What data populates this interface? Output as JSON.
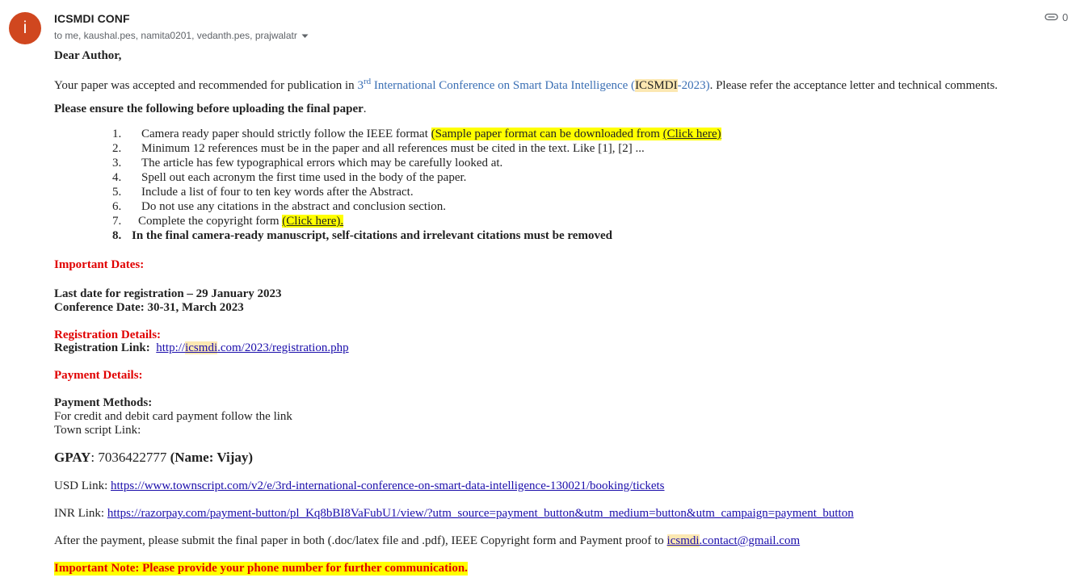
{
  "header": {
    "avatar_letter": "i",
    "sender": "ICSMDI CONF",
    "recipients": "to me, kaushal.pes, namita0201, vedanth.pes, prajwalatr",
    "attachment_count": "0"
  },
  "body": {
    "greeting": "Dear Author,",
    "p1_a": "Your paper was accepted and recommended for publication in ",
    "p1_conf_num": "3",
    "p1_conf_sup": "rd",
    "p1_conf_name": " International Conference on Smart Data Intelligence (",
    "p1_conf_abbr": "ICSMDI",
    "p1_conf_year": "-2023)",
    "p1_b": ". Please refer the acceptance letter and technical comments.",
    "ensure_bold": "Please ensure the following before uploading the final paper",
    "ensure_dot": ".",
    "list": [
      {
        "num": "1.",
        "text": "Camera ready paper should strictly follow the IEEE format ",
        "hl": "(Sample paper format can be downloaded from ",
        "link": "(Click here)"
      },
      {
        "num": "2.",
        "text": "Minimum 12 references must be in the paper and all references must be cited in the text. Like [1], [2] ..."
      },
      {
        "num": "3.",
        "text": "The article has few typographical errors which may be carefully looked at."
      },
      {
        "num": "4.",
        "text": "Spell out each acronym the first time used in the body of the paper."
      },
      {
        "num": "5.",
        "text": "Include a list of four to ten key words after the Abstract."
      },
      {
        "num": "6.",
        "text": "Do not use any citations in the abstract and conclusion section."
      },
      {
        "num": "7.",
        "text": "Complete the copyright form ",
        "link": "(Click here)."
      },
      {
        "num": "8.",
        "text": "In the final camera-ready manuscript, self-citations and irrelevant citations must be removed"
      }
    ],
    "important_dates_title": "Important Dates:",
    "last_date": "Last date for registration – 29 January 2023",
    "conf_date": "Conference Date: 30-31, March 2023",
    "registration_title": "Registration Details:",
    "registration_label": "Registration Link:",
    "registration_link_a": "http://",
    "registration_link_hl": "icsmdi",
    "registration_link_b": ".com/2023/registration.php",
    "payment_title": "Payment Details:",
    "payment_methods": "Payment Methods:",
    "payment_line1": "For credit and debit card payment follow the link",
    "payment_line2": "Town script Link:",
    "gpay_label": "GPAY",
    "gpay_number": ": 7036422777 ",
    "gpay_name": "(Name: Vijay)",
    "usd_label": "USD Link: ",
    "usd_link": "https://www.townscript.com/v2/e/3rd-international-conference-on-smart-data-intelligence-130021/booking/tickets",
    "inr_label": "INR Link: ",
    "inr_link": "https://razorpay.com/payment-button/pl_Kq8bBI8VaFubU1/view/?utm_source=payment_button&utm_medium=button&utm_campaign=payment_button",
    "after_payment": "After the payment, please submit the final paper in both (.doc/latex file and .pdf), IEEE Copyright form and Payment proof to ",
    "email_hl": "icsmdi",
    "email_rest": ".contact@gmail.com",
    "important_note": "Important Note: Please provide your phone number for further communication."
  }
}
